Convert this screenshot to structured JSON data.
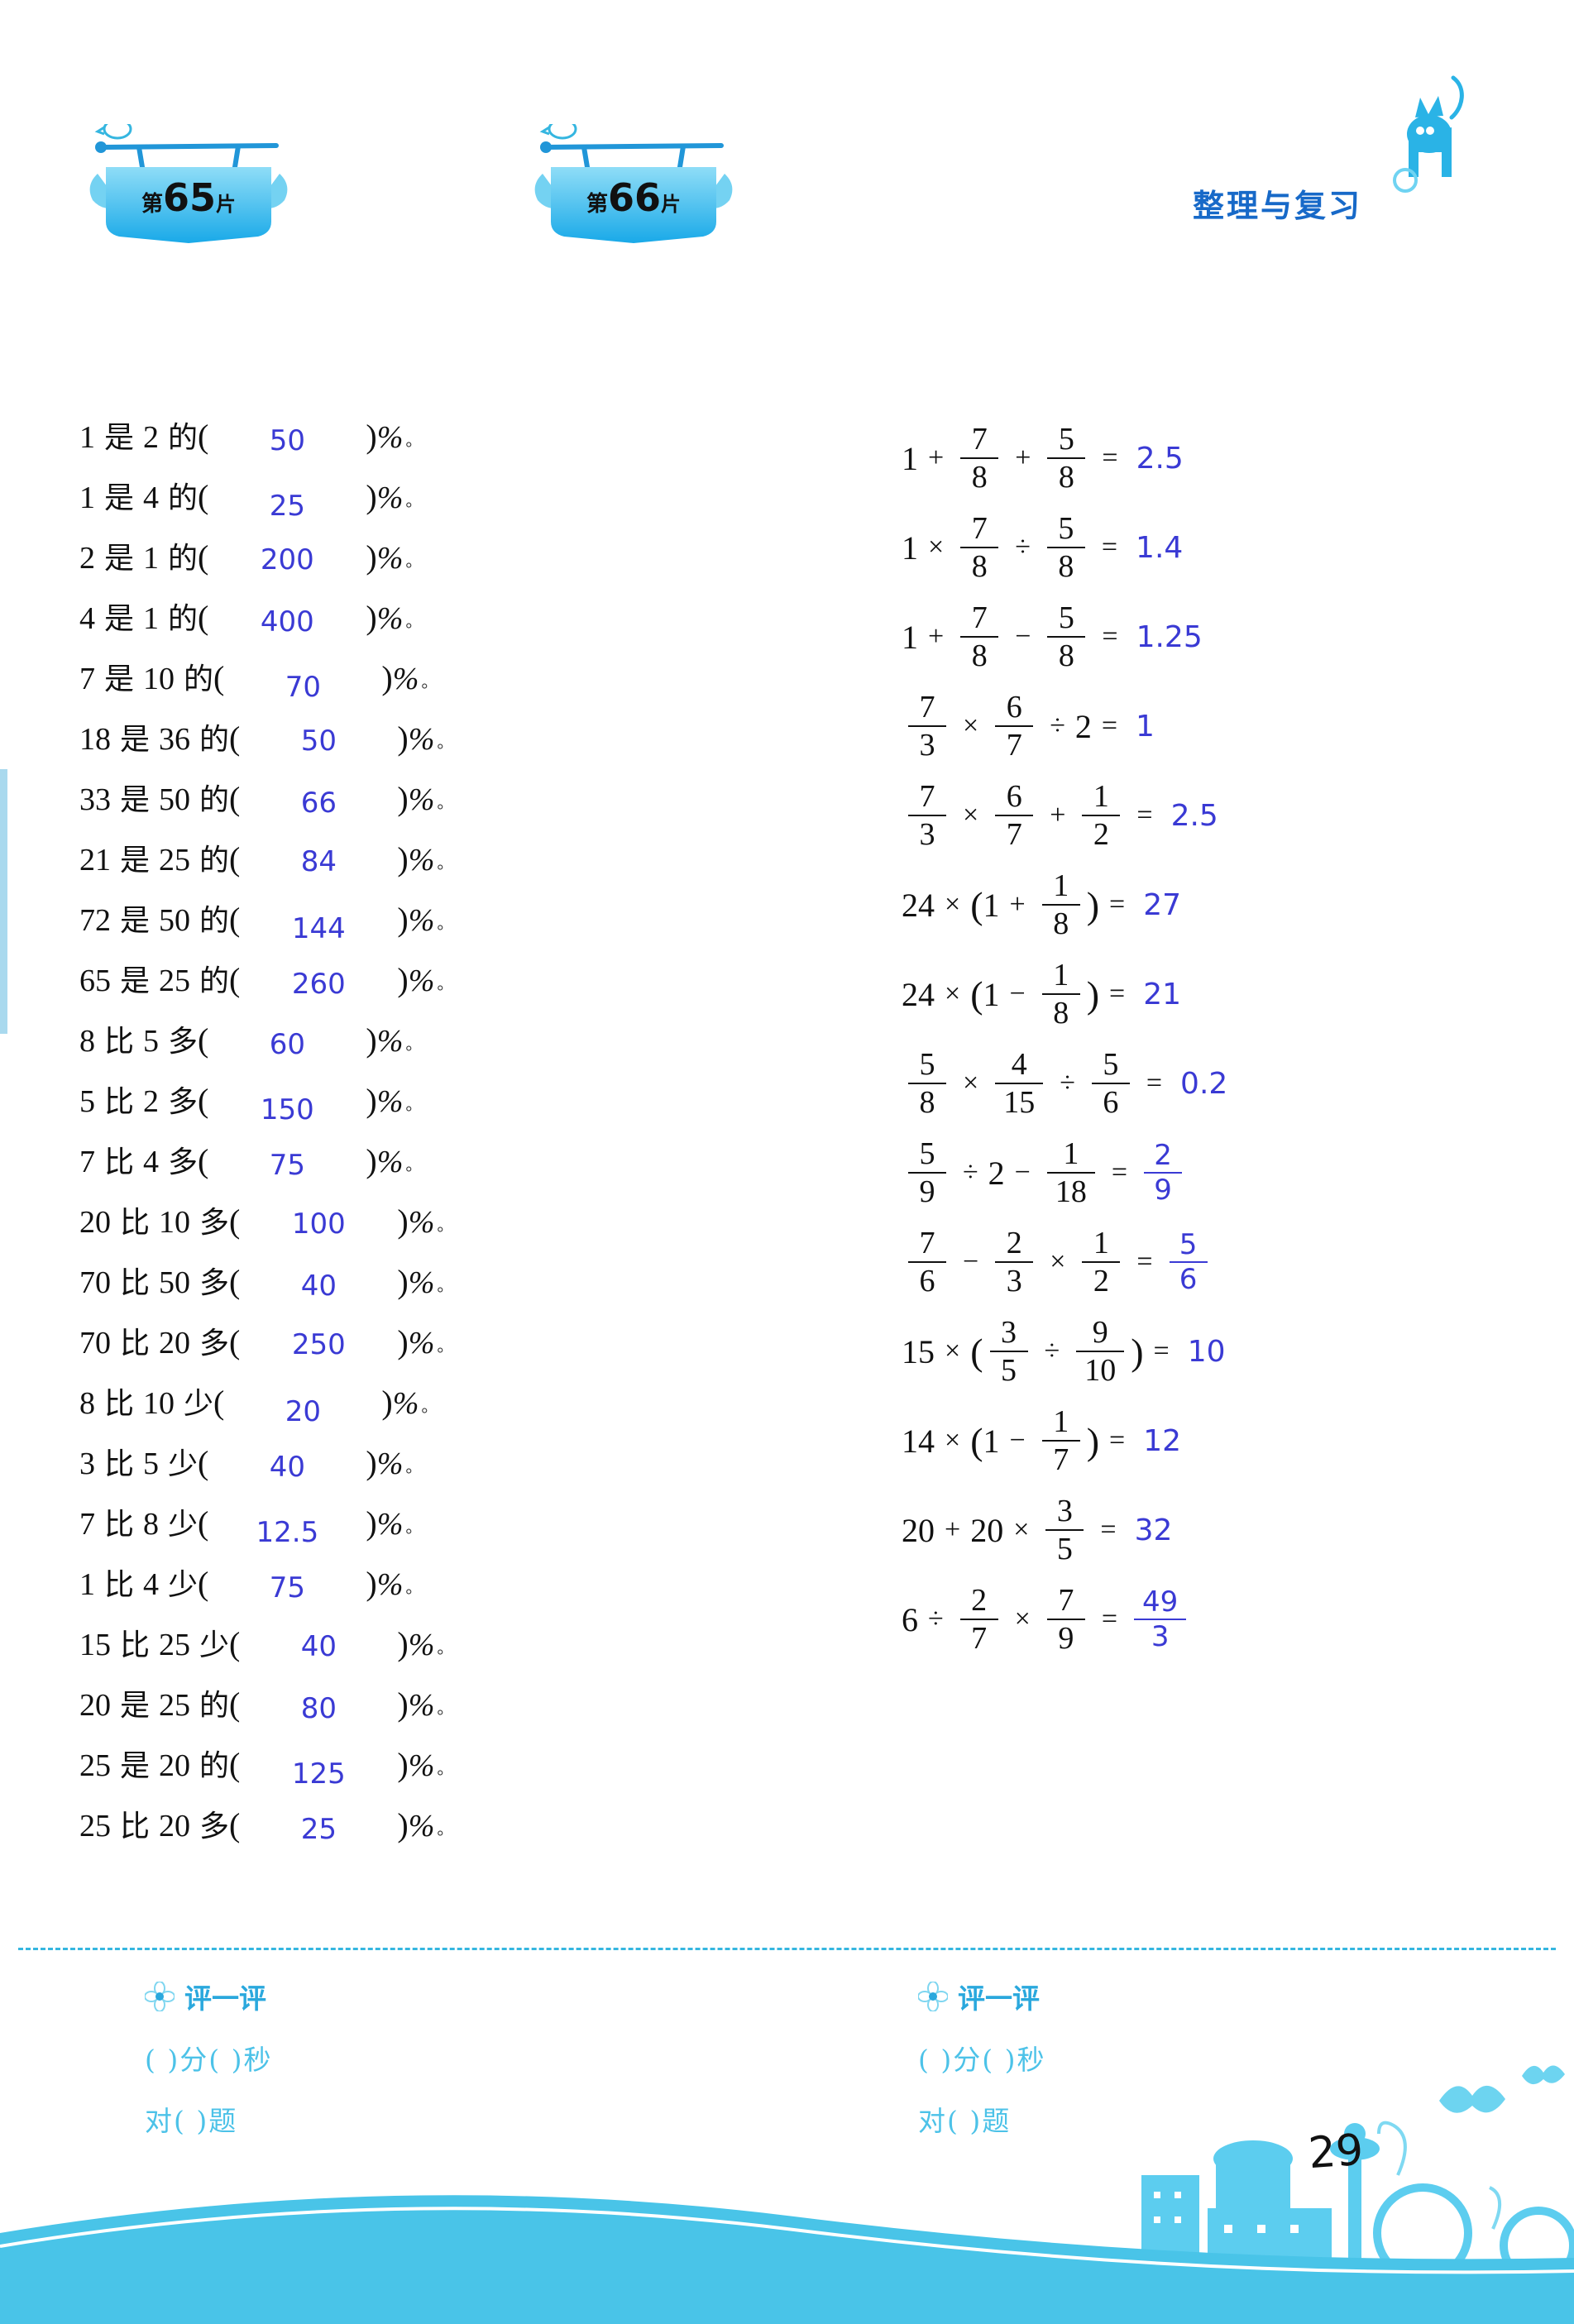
{
  "header": {
    "title": "整理与复习",
    "cat_icon": "cat-icon"
  },
  "page_number": "29",
  "sections": [
    {
      "badge": {
        "prefix": "第",
        "number": "65",
        "suffix": "片"
      },
      "type": "percent-fill",
      "rows": [
        {
          "a": "1",
          "rel": "是",
          "b": "2",
          "of": "的",
          "answer": "50",
          "shift": "d1"
        },
        {
          "a": "1",
          "rel": "是",
          "b": "4",
          "of": "的",
          "answer": "25",
          "shift": "d2"
        },
        {
          "a": "2",
          "rel": "是",
          "b": "1",
          "of": "的",
          "answer": "200",
          "shift": "d3"
        },
        {
          "a": "4",
          "rel": "是",
          "b": "1",
          "of": "的",
          "answer": "400",
          "shift": "d1"
        },
        {
          "a": "7",
          "rel": "是",
          "b": "10",
          "of": "的",
          "answer": "70",
          "shift": "d2"
        },
        {
          "a": "18",
          "rel": "是",
          "b": "36",
          "of": "的",
          "answer": "50",
          "shift": "d3"
        },
        {
          "a": "33",
          "rel": "是",
          "b": "50",
          "of": "的",
          "answer": "66",
          "shift": "d1"
        },
        {
          "a": "21",
          "rel": "是",
          "b": "25",
          "of": "的",
          "answer": "84",
          "shift": "d3"
        },
        {
          "a": "72",
          "rel": "是",
          "b": "50",
          "of": "的",
          "answer": "144",
          "shift": "d2"
        },
        {
          "a": "65",
          "rel": "是",
          "b": "25",
          "of": "的",
          "answer": "260",
          "shift": "d1"
        },
        {
          "a": "8",
          "rel": "比",
          "b": "5",
          "of": "多",
          "answer": "60",
          "shift": "d1"
        },
        {
          "a": "5",
          "rel": "比",
          "b": "2",
          "of": "多",
          "answer": "150",
          "shift": "d2"
        },
        {
          "a": "7",
          "rel": "比",
          "b": "4",
          "of": "多",
          "answer": "75",
          "shift": "d1"
        },
        {
          "a": "20",
          "rel": "比",
          "b": "10",
          "of": "多",
          "answer": "100",
          "shift": "d3"
        },
        {
          "a": "70",
          "rel": "比",
          "b": "50",
          "of": "多",
          "answer": "40",
          "shift": "d1"
        },
        {
          "a": "70",
          "rel": "比",
          "b": "20",
          "of": "多",
          "answer": "250",
          "shift": "d3"
        },
        {
          "a": "8",
          "rel": "比",
          "b": "10",
          "of": "少",
          "answer": "20",
          "shift": "d2"
        },
        {
          "a": "3",
          "rel": "比",
          "b": "5",
          "of": "少",
          "answer": "40",
          "shift": "d1"
        },
        {
          "a": "7",
          "rel": "比",
          "b": "8",
          "of": "少",
          "answer": "12.5",
          "shift": "d2"
        },
        {
          "a": "1",
          "rel": "比",
          "b": "4",
          "of": "少",
          "answer": "75",
          "shift": "d1"
        },
        {
          "a": "15",
          "rel": "比",
          "b": "25",
          "of": "少",
          "answer": "40",
          "shift": "d3"
        },
        {
          "a": "20",
          "rel": "是",
          "b": "25",
          "of": "的",
          "answer": "80",
          "shift": "d1"
        },
        {
          "a": "25",
          "rel": "是",
          "b": "20",
          "of": "的",
          "answer": "125",
          "shift": "d2"
        },
        {
          "a": "25",
          "rel": "比",
          "b": "20",
          "of": "多",
          "answer": "25",
          "shift": "d1"
        }
      ],
      "open_paren": "(",
      "close_paren": ")",
      "percent_sign": "%",
      "period": "。"
    },
    {
      "badge": {
        "prefix": "第",
        "number": "66",
        "suffix": "片"
      },
      "type": "fraction-equations",
      "equations": [
        {
          "id": 1,
          "terms": [
            "1",
            "+",
            "7/8",
            "+",
            "5/8"
          ],
          "answer": "2.5",
          "answer_type": "number"
        },
        {
          "id": 2,
          "terms": [
            "1",
            "×",
            "7/8",
            "÷",
            "5/8"
          ],
          "answer": "1.4",
          "answer_type": "number"
        },
        {
          "id": 3,
          "terms": [
            "1",
            "+",
            "7/8",
            "−",
            "5/8"
          ],
          "answer": "1.25",
          "answer_type": "number"
        },
        {
          "id": 4,
          "terms": [
            "7/3",
            "×",
            "6/7",
            "÷",
            "2"
          ],
          "answer": "1",
          "answer_type": "number"
        },
        {
          "id": 5,
          "terms": [
            "7/3",
            "×",
            "6/7",
            "+",
            "1/2"
          ],
          "answer": "2.5",
          "answer_type": "number"
        },
        {
          "id": 6,
          "terms": [
            "24",
            "×",
            "(",
            "1",
            "+",
            "1/8",
            ")"
          ],
          "answer": "27",
          "answer_type": "number"
        },
        {
          "id": 7,
          "terms": [
            "24",
            "×",
            "(",
            "1",
            "−",
            "1/8",
            ")"
          ],
          "answer": "21",
          "answer_type": "number"
        },
        {
          "id": 8,
          "terms": [
            "5/8",
            "×",
            "4/15",
            "÷",
            "5/6"
          ],
          "answer": "0.2",
          "answer_type": "number"
        },
        {
          "id": 9,
          "terms": [
            "5/9",
            "÷",
            "2",
            "−",
            "1/18"
          ],
          "answer": "2/9",
          "answer_type": "fraction",
          "answer_num": "2",
          "answer_den": "9"
        },
        {
          "id": 10,
          "terms": [
            "7/6",
            "−",
            "2/3",
            "×",
            "1/2"
          ],
          "answer": "5/6",
          "answer_type": "fraction",
          "answer_num": "5",
          "answer_den": "6"
        },
        {
          "id": 11,
          "terms": [
            "15",
            "×",
            "(",
            "3/5",
            "÷",
            "9/10",
            ")"
          ],
          "answer": "10",
          "answer_type": "number"
        },
        {
          "id": 12,
          "terms": [
            "14",
            "×",
            "(",
            "1",
            "−",
            "1/7",
            ")"
          ],
          "answer": "12",
          "answer_type": "number"
        },
        {
          "id": 13,
          "terms": [
            "20",
            "+",
            "20",
            "×",
            "3/5"
          ],
          "answer": "32",
          "answer_type": "number"
        },
        {
          "id": 14,
          "terms": [
            "6",
            "÷",
            "2/7",
            "×",
            "7/9"
          ],
          "answer": "49/3",
          "answer_type": "fraction",
          "answer_num": "49",
          "answer_den": "3"
        }
      ],
      "equals": "="
    }
  ],
  "footer": {
    "left": {
      "title": "评一评",
      "time_line": "(    )分(    )秒",
      "count_line": "对(    )题",
      "flower_icon": "flower-icon"
    },
    "right": {
      "title": "评一评",
      "time_line": "(    )分(    )秒",
      "count_line": "对(    )题",
      "flower_icon": "flower-icon"
    }
  },
  "colors": {
    "answer_blue": "#3a3ad4",
    "decor_cyan": "#35b6e0",
    "title_blue": "#1769c8"
  }
}
